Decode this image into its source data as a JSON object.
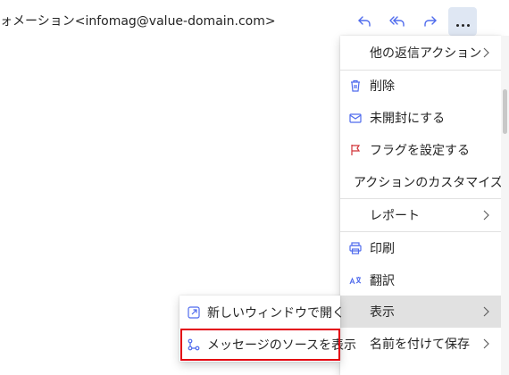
{
  "header": {
    "sender_text": "ォメーション<infomag@value-domain.com>"
  },
  "toolbar": {
    "reply_icon": "reply-icon",
    "reply_all_icon": "reply-all-icon",
    "forward_icon": "forward-icon",
    "more_icon": "more-icon",
    "accent_color": "#4f6bed"
  },
  "menu": {
    "items": [
      {
        "label": "他の返信アクション",
        "icon": "",
        "submenu": true
      },
      {
        "label": "削除",
        "icon": "trash-icon"
      },
      {
        "label": "未開封にする",
        "icon": "mail-icon"
      },
      {
        "label": "フラグを設定する",
        "icon": "flag-icon"
      },
      {
        "label": "アクションのカスタマイズ",
        "icon": ""
      },
      {
        "label": "レポート",
        "icon": "",
        "submenu": true
      },
      {
        "label": "印刷",
        "icon": "print-icon"
      },
      {
        "label": "翻訳",
        "icon": "translate-icon"
      },
      {
        "label": "表示",
        "icon": "",
        "submenu": true,
        "highlighted": true
      },
      {
        "label": "名前を付けて保存",
        "icon": "",
        "submenu": true
      }
    ]
  },
  "submenu": {
    "items": [
      {
        "label": "新しいウィンドウで開く",
        "icon": "open-new-window-icon"
      },
      {
        "label": "メッセージのソースを表示",
        "icon": "view-source-icon",
        "highlighted_box": true
      }
    ],
    "highlight_color": "#e3000f"
  }
}
